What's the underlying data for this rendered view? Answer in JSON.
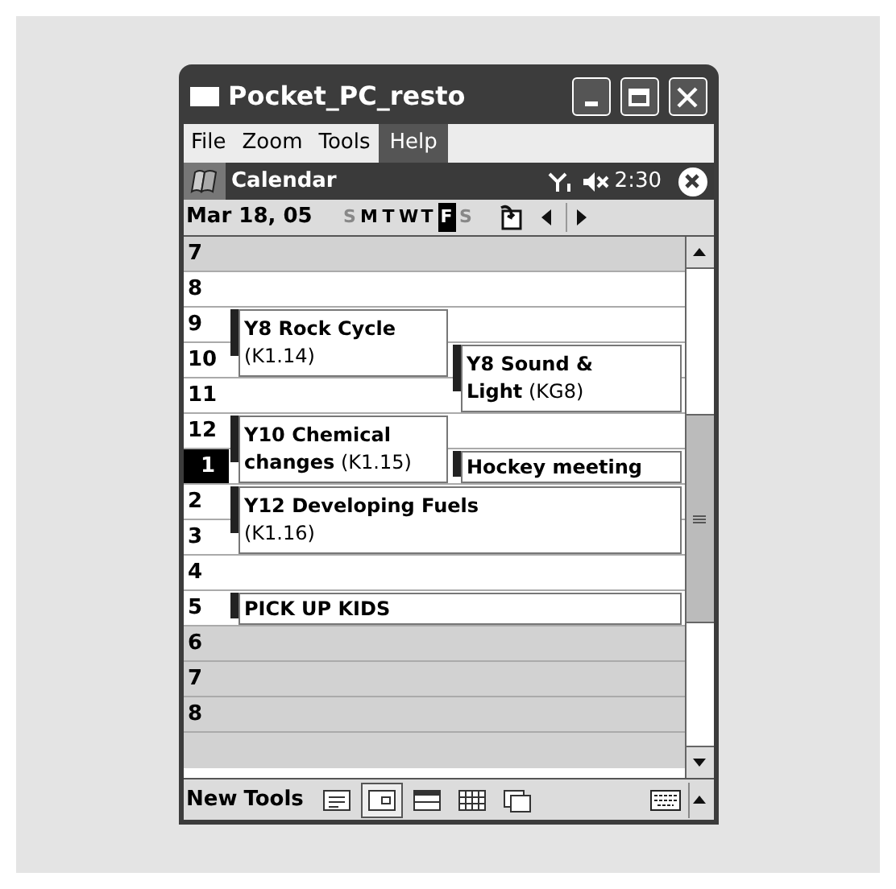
{
  "window": {
    "title": "Pocket_PC_resto"
  },
  "menu": [
    {
      "label": "File",
      "selected": false
    },
    {
      "label": "Zoom",
      "selected": false
    },
    {
      "label": "Tools",
      "selected": false
    },
    {
      "label": "Help",
      "selected": true
    }
  ],
  "nav_bar": {
    "app": "Calendar",
    "time": "2:30"
  },
  "date_bar": {
    "date": "Mar 18, 05",
    "days": [
      {
        "letter": "S",
        "weekend": true,
        "selected": false
      },
      {
        "letter": "M",
        "weekend": false,
        "selected": false
      },
      {
        "letter": "T",
        "weekend": false,
        "selected": false
      },
      {
        "letter": "W",
        "weekend": false,
        "selected": false
      },
      {
        "letter": "T",
        "weekend": false,
        "selected": false
      },
      {
        "letter": "F",
        "weekend": false,
        "selected": true
      },
      {
        "letter": "S",
        "weekend": true,
        "selected": false
      }
    ]
  },
  "hours": [
    {
      "label": "7",
      "work": false,
      "selected": false
    },
    {
      "label": "8",
      "work": true,
      "selected": false
    },
    {
      "label": "9",
      "work": true,
      "selected": false,
      "events": [
        {
          "title": "Y8 Rock Cycle",
          "detail": "(K1.14)",
          "kind": "left",
          "tall": true
        }
      ]
    },
    {
      "label": "10",
      "work": true,
      "selected": false,
      "events": [
        {
          "title": "Y8 Sound &",
          "title2": "Light",
          "detail": "(KG8)",
          "kind": "right",
          "tall": true
        }
      ]
    },
    {
      "label": "11",
      "work": true,
      "selected": false
    },
    {
      "label": "12",
      "work": true,
      "selected": false,
      "events": [
        {
          "title": "Y10 Chemical",
          "title2": "changes",
          "detail": "(K1.15)",
          "kind": "left",
          "tall": true
        }
      ]
    },
    {
      "label": "1",
      "work": true,
      "selected": true,
      "events": [
        {
          "title": "Hockey meeting",
          "kind": "right",
          "tall": false
        }
      ]
    },
    {
      "label": "2",
      "work": true,
      "selected": false,
      "events": [
        {
          "title": "Y12 Developing Fuels",
          "detail": "(K1.16)",
          "kind": "full",
          "tall": true
        }
      ]
    },
    {
      "label": "3",
      "work": true,
      "selected": false
    },
    {
      "label": "4",
      "work": true,
      "selected": false
    },
    {
      "label": "5",
      "work": true,
      "selected": false,
      "events": [
        {
          "title": "PICK UP KIDS",
          "kind": "full",
          "tall": false
        }
      ]
    },
    {
      "label": "6",
      "work": false,
      "selected": false
    },
    {
      "label": "7",
      "work": false,
      "selected": false
    },
    {
      "label": "8",
      "work": false,
      "selected": false
    }
  ],
  "toolbar": {
    "items": [
      {
        "label": "New"
      },
      {
        "label": "Tools"
      }
    ],
    "views": [
      {
        "selected": false
      },
      {
        "selected": true
      },
      {
        "selected": false
      },
      {
        "selected": false
      },
      {
        "selected": false
      }
    ]
  }
}
